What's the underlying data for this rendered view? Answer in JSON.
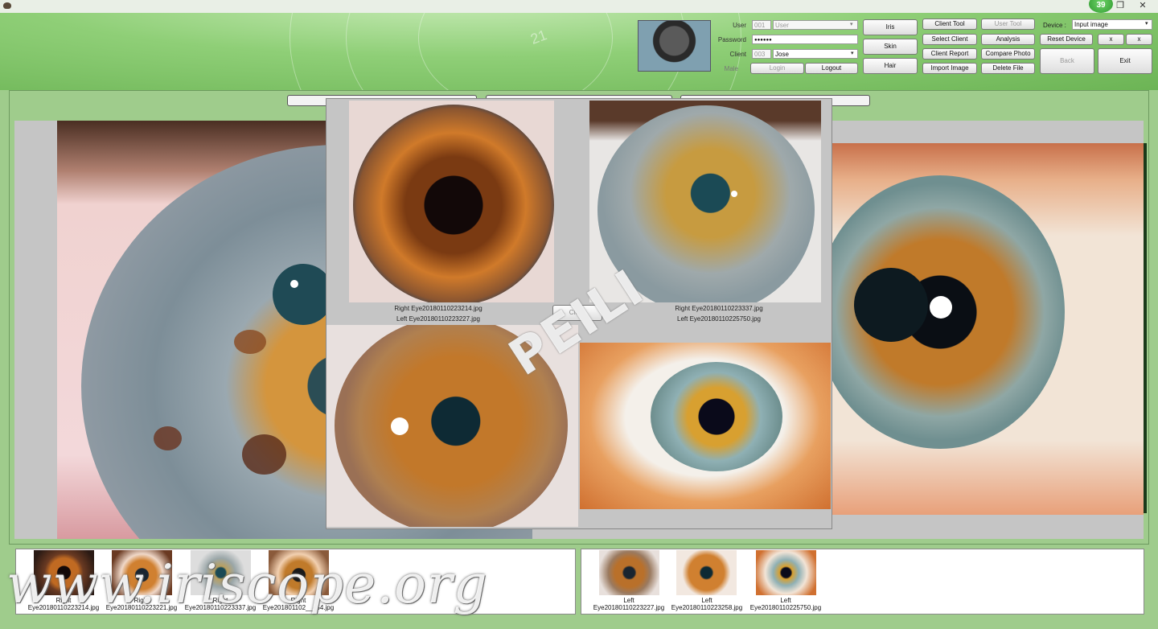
{
  "titlebar": {
    "badge": "39",
    "restore_glyph": "❐",
    "close_glyph": "✕"
  },
  "login": {
    "user_label": "User",
    "user_id": "001",
    "user_placeholder": "User",
    "password_label": "Password",
    "password_value": "●●●●●●",
    "client_label": "Client",
    "client_id": "003",
    "client_name": "Jose",
    "gender": "Male",
    "login_label": "Login",
    "logout_label": "Logout"
  },
  "modes": {
    "iris": "Iris",
    "skin": "Skin",
    "hair": "Hair"
  },
  "tools": {
    "client_tool": "Client Tool",
    "user_tool": "User Tool",
    "select_client": "Select Client",
    "analysis": "Analysis",
    "client_report": "Client Report",
    "compare_photo": "Compare Photo",
    "import_image": "Import Image",
    "delete_file": "Delete File"
  },
  "device": {
    "label": "Device :",
    "selected": "Input image",
    "reset_label": "Reset Device",
    "x1": "x",
    "x2": "x",
    "back_label": "Back",
    "exit_label": "Exit"
  },
  "compare": {
    "caption_left_1": "Right Eye20180110223214.jpg",
    "caption_left_2": "Left Eye20180110223227.jpg",
    "caption_right_1": "Right Eye20180110223337.jpg",
    "caption_right_2": "Left Eye20180110225750.jpg",
    "close_label": "Close",
    "watermark": "PEILI"
  },
  "thumbs_right_eye": [
    {
      "side": "Right",
      "file": "Eye20180110223214.jpg"
    },
    {
      "side": "Right",
      "file": "Eye20180110223221.jpg"
    },
    {
      "side": "Right",
      "file": "Eye20180110223337.jpg"
    },
    {
      "side": "Right",
      "file": "Eye201801102__454.jpg"
    }
  ],
  "thumbs_left_eye": [
    {
      "side": "Left",
      "file": "Eye20180110223227.jpg"
    },
    {
      "side": "Left",
      "file": "Eye20180110223258.jpg"
    },
    {
      "side": "Left",
      "file": "Eye20180110225750.jpg"
    }
  ],
  "watermark_site": "www.iriscope.org",
  "colors": {
    "header_green": "#8fcf77",
    "panel_green": "#9fcc8c",
    "panel_gray": "#c5c5c5"
  }
}
